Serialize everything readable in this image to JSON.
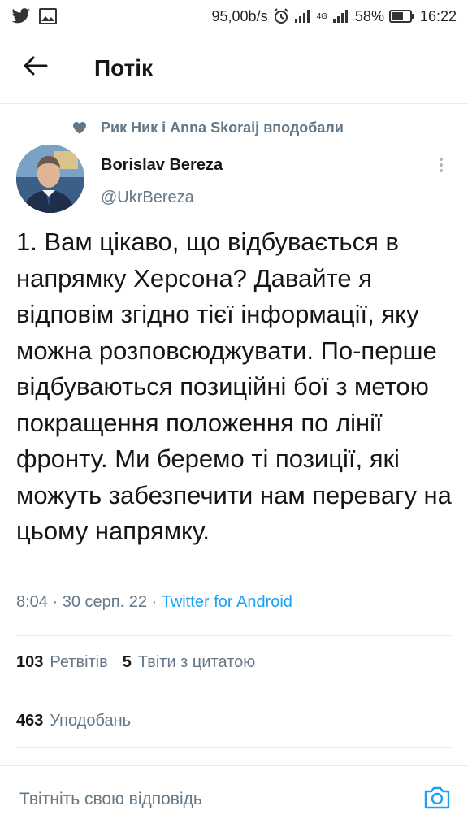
{
  "status_bar": {
    "network_speed": "95,00b/s",
    "network_type": "4G",
    "battery": "58%",
    "time": "16:22",
    "icons": [
      "twitter-icon",
      "image-icon",
      "alarm-icon",
      "signal-icon",
      "signal-4g-icon",
      "battery-icon"
    ]
  },
  "header": {
    "title": "Потік",
    "back_icon": "arrow-left-icon"
  },
  "social_context": {
    "icon": "heart-icon",
    "text": "Рик Ник і Anna Skoraij вподобали"
  },
  "author": {
    "name": "Borislav Bereza",
    "handle": "@UkrBereza",
    "more_icon": "more-vertical-icon"
  },
  "tweet": {
    "text": "1. Вам цікаво, що відбувається в напрямку Херсона? Давайте я відповім згідно тієї інформації, яку можна розповсюджувати. По-перше відбуваються позиційні бої з метою покращення положення по лінії фронту. Ми беремо ті позиції, які можуть забезпечити нам перевагу на цьому напрямку.",
    "time": "8:04",
    "date": "30 серп. 22",
    "source": "Twitter for Android",
    "separator": " · "
  },
  "stats": {
    "retweets_count": "103",
    "retweets_label": "Ретвітів",
    "quotes_count": "5",
    "quotes_label": "Твіти з цитатою",
    "likes_count": "463",
    "likes_label": "Уподобань"
  },
  "reply": {
    "placeholder": "Твітніть свою відповідь",
    "camera_icon": "camera-icon"
  },
  "colors": {
    "accent": "#1da1f2",
    "secondary_text": "#657786",
    "primary_text": "#14171a",
    "divider": "#e6ecf0"
  }
}
